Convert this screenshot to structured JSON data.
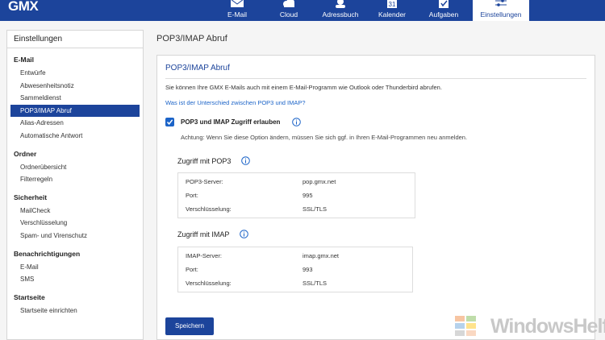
{
  "app": {
    "logo": "GMX"
  },
  "nav": [
    {
      "label": "E-Mail",
      "icon": "mail-icon",
      "active": false
    },
    {
      "label": "Cloud",
      "icon": "cloud-icon",
      "active": false
    },
    {
      "label": "Adressbuch",
      "icon": "address-book-icon",
      "active": false
    },
    {
      "label": "Kalender",
      "icon": "calendar-icon",
      "active": false
    },
    {
      "label": "Aufgaben",
      "icon": "tasks-icon",
      "active": false
    },
    {
      "label": "Einstellungen",
      "icon": "settings-sliders-icon",
      "active": true
    }
  ],
  "calendar_day": "31",
  "sidebar": {
    "title": "Einstellungen",
    "sections": [
      {
        "title": "E-Mail",
        "items": [
          "Entwürfe",
          "Abwesenheitsnotiz",
          "Sammeldienst",
          "POP3/IMAP Abruf",
          "Alias-Adressen",
          "Automatische Antwort"
        ]
      },
      {
        "title": "Ordner",
        "items": [
          "Ordnerübersicht",
          "Filterregeln"
        ]
      },
      {
        "title": "Sicherheit",
        "items": [
          "MailCheck",
          "Verschlüsselung",
          "Spam- und Virenschutz"
        ]
      },
      {
        "title": "Benachrichtigungen",
        "items": [
          "E-Mail",
          "SMS"
        ]
      },
      {
        "title": "Startseite",
        "items": [
          "Startseite einrichten"
        ]
      }
    ],
    "active_item": "POP3/IMAP Abruf"
  },
  "main": {
    "page_title": "POP3/IMAP Abruf",
    "panel_title": "POP3/IMAP Abruf",
    "intro": "Sie können Ihre GMX E-Mails auch mit einem E-Mail-Programm wie Outlook oder Thunderbird abrufen.",
    "link": "Was ist der Unterschied zwischen POP3 und IMAP?",
    "checkbox_label": "POP3 und IMAP Zugriff erlauben",
    "checkbox_checked": true,
    "warning": "Achtung: Wenn Sie diese Option ändern, müssen Sie sich ggf. in Ihren E-Mail-Programmen neu anmelden.",
    "pop3": {
      "heading": "Zugriff mit POP3",
      "rows": [
        {
          "key": "POP3-Server:",
          "value": "pop.gmx.net"
        },
        {
          "key": "Port:",
          "value": "995"
        },
        {
          "key": "Verschlüsselung:",
          "value": "SSL/TLS"
        }
      ]
    },
    "imap": {
      "heading": "Zugriff mit IMAP",
      "rows": [
        {
          "key": "IMAP-Server:",
          "value": "imap.gmx.net"
        },
        {
          "key": "Port:",
          "value": "993"
        },
        {
          "key": "Verschlüsselung:",
          "value": "SSL/TLS"
        }
      ]
    },
    "save_label": "Speichern"
  },
  "watermark": {
    "text": "WindowsHelfer"
  },
  "colors": {
    "brand": "#1c449b",
    "link": "#1c64c8",
    "background": "#f5f5f5"
  }
}
